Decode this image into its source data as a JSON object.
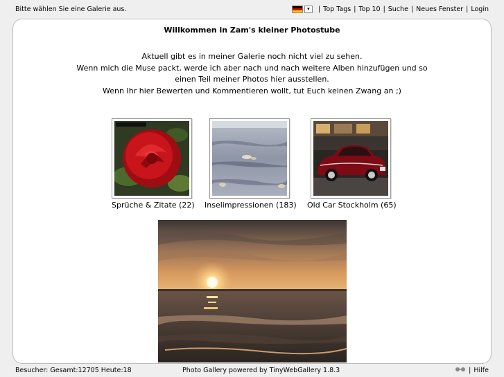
{
  "topbar": {
    "status": "Bitte wählen Sie eine Galerie aus.",
    "language_icon": "german-flag-icon",
    "links": [
      "Top Tags",
      "Top 10",
      "Suche",
      "Neues Fenster",
      "Login"
    ],
    "separator": "|"
  },
  "main": {
    "title": "Willkommen in Zam's kleiner Photostube",
    "intro": [
      "Aktuell gibt es in meiner Galerie noch nicht viel zu sehen.",
      "Wenn mich die Muse packt, werde ich aber nach und nach weitere Alben hinzufügen und so",
      "einen Teil meiner Photos hier ausstellen.",
      "Wenn Ihr hier Bewerten und Kommentieren wollt, tut Euch keinen Zwang an ;)"
    ],
    "galleries": [
      {
        "label": "Sprüche & Zitate (22)",
        "image": "red-rose-photo"
      },
      {
        "label": "Inselimpressionen (183)",
        "image": "seals-on-mudflat-photo"
      },
      {
        "label": "Old Car Stockholm (65)",
        "image": "vintage-red-car-photo"
      }
    ],
    "featured_image": "sunset-over-sea-photo"
  },
  "footer": {
    "visitors": "Besucher: Gesamt:12705 Heute:18",
    "powered_by": "Photo Gallery powered by TinyWebGallery 1.8.3",
    "help": "Hilfe",
    "separator": "|"
  },
  "colors": {
    "background": "#efefef",
    "panel": "#ffffff",
    "border": "#bdbdbd"
  }
}
